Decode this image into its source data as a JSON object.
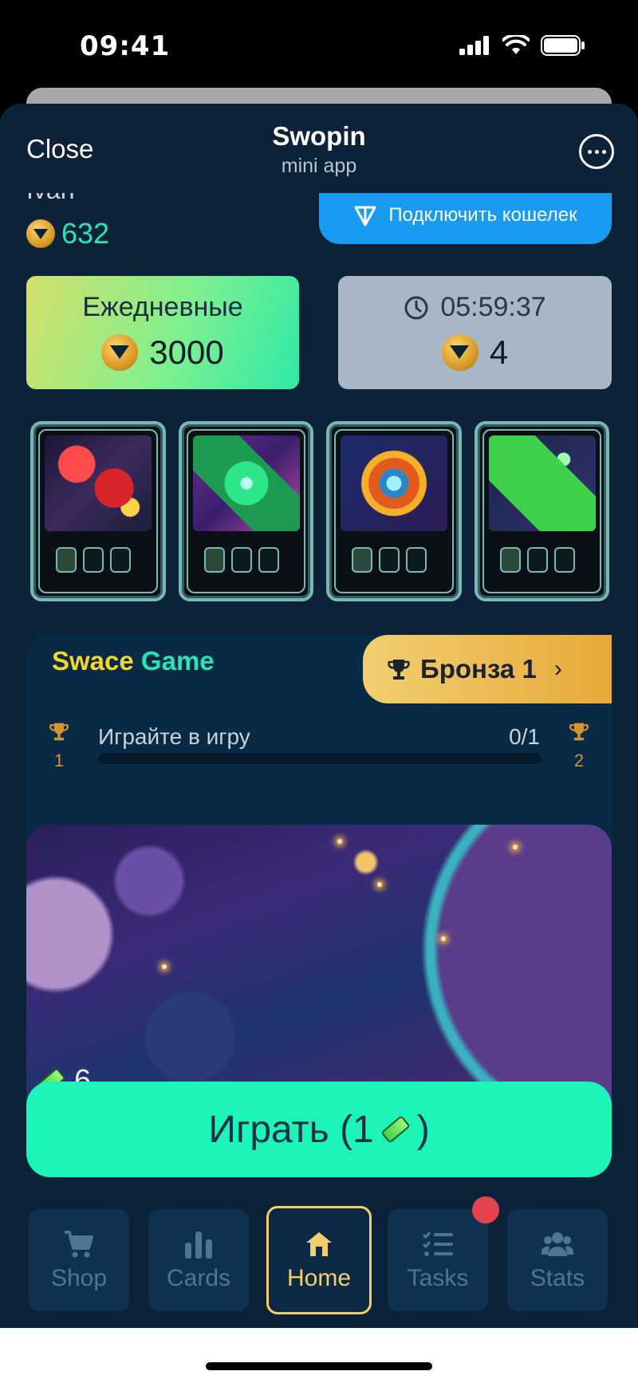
{
  "status_bar": {
    "time": "09:41"
  },
  "header": {
    "close_label": "Close",
    "title": "Swopin",
    "subtitle": "mini app"
  },
  "profile": {
    "name": "Ivan",
    "balance": "632",
    "connect_wallet_label": "Подключить кошелек"
  },
  "daily": {
    "title": "Ежедневные",
    "reward": "3000"
  },
  "timer": {
    "countdown": "05:59:37",
    "count": "4"
  },
  "cards": [
    {
      "name": "magnet-card"
    },
    {
      "name": "emerald-card"
    },
    {
      "name": "mandala-card"
    },
    {
      "name": "battery-card"
    }
  ],
  "game": {
    "title_part1": "Swace",
    "title_part2": "Game",
    "rank_label": "Бронза 1",
    "task_label": "Играйте в игру",
    "task_progress": "0/1",
    "progress_fraction": 0,
    "level_from": "1",
    "level_to": "2",
    "tickets": "6",
    "play_label": "Играть (1",
    "play_label_end": ")"
  },
  "nav": {
    "items": [
      {
        "label": "Shop",
        "icon": "cart-icon"
      },
      {
        "label": "Cards",
        "icon": "bar-chart-icon"
      },
      {
        "label": "Home",
        "icon": "home-icon"
      },
      {
        "label": "Tasks",
        "icon": "checklist-icon"
      },
      {
        "label": "Stats",
        "icon": "users-icon"
      }
    ],
    "active": "Home"
  },
  "colors": {
    "background": "#0b2238",
    "accent_mint": "#1df5b8",
    "accent_gold": "#f1cf70",
    "wallet_blue": "#1a9bf2",
    "notification_red": "#e5444f"
  }
}
